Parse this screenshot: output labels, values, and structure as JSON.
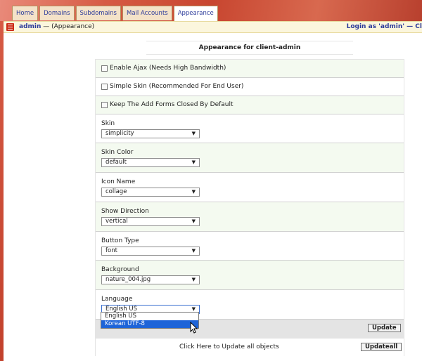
{
  "tabs": [
    "Home",
    "Domains",
    "Subdomains",
    "Mail Accounts",
    "Appearance"
  ],
  "active_tab": "Appearance",
  "header": {
    "user": "admin",
    "page": " — (Appearance)",
    "login_info": "Login as 'admin' — Cl"
  },
  "form_title": "Appearance for client-admin",
  "checkboxes": [
    {
      "label": "Enable Ajax (Needs High Bandwidth)",
      "checked": false
    },
    {
      "label": "Simple Skin (Recommended For End User)",
      "checked": false
    },
    {
      "label": "Keep The Add Forms Closed By Default",
      "checked": false
    }
  ],
  "fields": [
    {
      "label": "Skin",
      "value": "simplicity"
    },
    {
      "label": "Skin Color",
      "value": "default"
    },
    {
      "label": "Icon Name",
      "value": "collage"
    },
    {
      "label": "Show Direction",
      "value": "vertical"
    },
    {
      "label": "Button Type",
      "value": "font"
    },
    {
      "label": "Background",
      "value": "nature_004.jpg"
    },
    {
      "label": "Language",
      "value": "English US"
    }
  ],
  "language_dropdown": {
    "options": [
      "English US",
      "Korean UTF-8"
    ],
    "highlighted": "Korean UTF-8"
  },
  "update_button": "Update",
  "update_all_text": "Click Here to Update all objects",
  "update_all_button": "Updateall",
  "colors": {
    "link": "#2b3a9a",
    "header_bg": "#fbf6dd",
    "top_bg": "#c84630",
    "highlight": "#1e64d8"
  }
}
